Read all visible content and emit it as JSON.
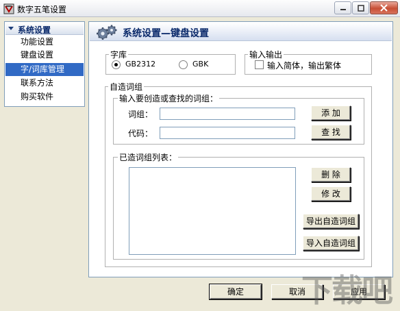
{
  "window": {
    "title": "数字五笔设置"
  },
  "sidebar": {
    "header": "系统设置",
    "items": [
      {
        "label": "功能设置"
      },
      {
        "label": "键盘设置"
      },
      {
        "label": "字/词库管理",
        "selected": true
      },
      {
        "label": "联系方法"
      },
      {
        "label": "购买软件"
      }
    ]
  },
  "main": {
    "title": "系统设置—键盘设置",
    "zipku": {
      "legend": "字库",
      "options": [
        "GB2312",
        "GBK"
      ],
      "selected": "GB2312"
    },
    "io": {
      "legend": "输入输出",
      "checkbox_label": "输入简体，输出繁体",
      "checked": false
    },
    "custom": {
      "legend": "自造词组",
      "input_group": {
        "legend": "输入要创造或查找的词组：",
        "word_label": "词组：",
        "word_value": "",
        "code_label": "代码：",
        "code_value": "",
        "add_label": "添  加",
        "find_label": "查  找"
      },
      "list_group": {
        "legend": "已造词组列表：",
        "items": [],
        "delete_label": "删  除",
        "edit_label": "修  改",
        "export_label": "导出自造词组",
        "import_label": "导入自造词组"
      }
    }
  },
  "footer": {
    "ok_label": "确定",
    "cancel_label": "取消",
    "apply_label": "应用"
  },
  "watermark": {
    "text": "下载吧"
  },
  "colors": {
    "selection": "#316ac5",
    "header_text": "#0b2a6b",
    "dialog_bg": "#ece9d8"
  }
}
